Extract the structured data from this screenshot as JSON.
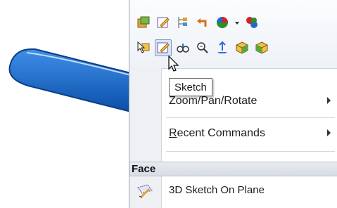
{
  "toolbar": {
    "row1": [
      {
        "icon": "part-icon"
      },
      {
        "icon": "edit-icon"
      },
      {
        "icon": "tree-icon"
      },
      {
        "icon": "undo-arrow-icon"
      },
      {
        "icon": "appearance-icon"
      },
      {
        "icon": "color-dropdown-icon"
      },
      {
        "icon": "appearances-icon"
      }
    ],
    "row2": [
      {
        "icon": "select-icon"
      },
      {
        "icon": "sketch-icon"
      },
      {
        "icon": "smart-dimension-icon"
      },
      {
        "icon": "zoom-icon"
      },
      {
        "icon": "normal-to-icon"
      },
      {
        "icon": "face-icon"
      },
      {
        "icon": "face-alt-icon"
      }
    ]
  },
  "tooltip": "Sketch",
  "menu": {
    "items": [
      {
        "label_prefix": "",
        "label": "Zoom/Pan/Rotate",
        "has_submenu": true
      },
      {
        "label_prefix": "R",
        "label": "ecent Commands",
        "has_submenu": true
      }
    ],
    "section_title": "Face",
    "face_items": [
      {
        "label": "3D Sketch On Plane",
        "icon": "3d-sketch-icon"
      }
    ]
  },
  "colors": {
    "part_blue": "#1565c9",
    "accent": "#7d99bd"
  }
}
